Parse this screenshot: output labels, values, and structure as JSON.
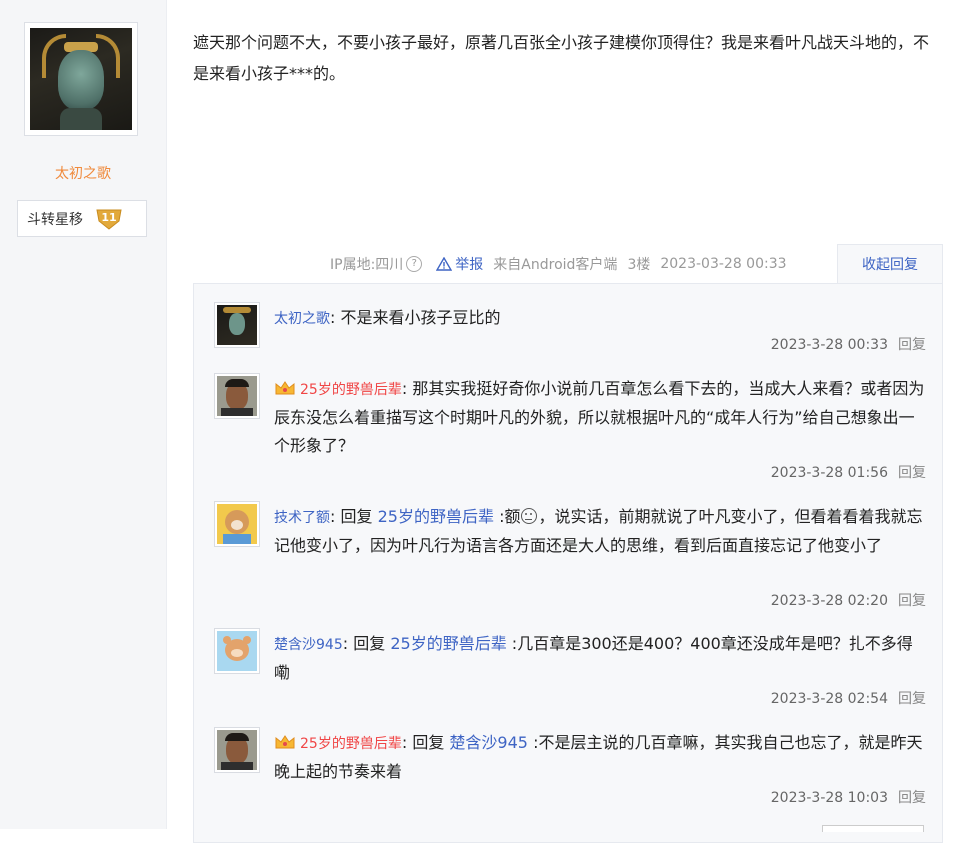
{
  "sidebar": {
    "username": "太初之歌",
    "level_name": "斗转星移",
    "level_number": "11"
  },
  "post": {
    "text": "遮天那个问题不大，不要小孩子最好，原著几百张全小孩子建模你顶得住？我是来看叶凡战天斗地的，不是来看小孩子***的。",
    "ip_label": "IP属地:四川",
    "report_label": "举报",
    "client": "来自Android客户端",
    "floor": "3楼",
    "timestamp": "2023-03-28 00:33",
    "collapse_label": "收起回复"
  },
  "replies": [
    {
      "user": "太初之歌",
      "text": "不是来看小孩子豆比的",
      "time": "2023-3-28 00:33",
      "reply_label": "回复"
    },
    {
      "user": "25岁的野兽后辈",
      "text": "那其实我挺好奇你小说前几百章怎么看下去的，当成大人来看？或者因为辰东没怎么着重描写这个时期叶凡的外貌，所以就根据叶凡的“成年人行为”给自己想象出一个形象了？",
      "time": "2023-3-28 01:56",
      "reply_label": "回复"
    },
    {
      "user": "技术了额",
      "reply_word": "回复",
      "reply_to": "25岁的野兽后辈",
      "text_pre": "额",
      "text": "，说实话，前期就说了叶凡变小了，但看着看着我就忘记他变小了，因为叶凡行为语言各方面还是大人的思维，看到后面直接忘记了他变小了",
      "time": "2023-3-28 02:20",
      "reply_label": "回复"
    },
    {
      "user": "楚含沙945",
      "reply_word": "回复",
      "reply_to": "25岁的野兽后辈",
      "text": "几百章是300还是400？400章还没成年是吧？扎不多得嘞",
      "time": "2023-3-28 02:54",
      "reply_label": "回复"
    },
    {
      "user": "25岁的野兽后辈",
      "reply_word": "回复",
      "reply_to": "楚含沙945",
      "text": "不是层主说的几百章嘛，其实我自己也忘了，就是昨天晚上起的节奏来着",
      "time": "2023-3-28 10:03",
      "reply_label": "回复"
    }
  ],
  "colors": {
    "link": "#3e64c4",
    "vip_name": "#f04646",
    "author_name": "#f08a3c"
  }
}
